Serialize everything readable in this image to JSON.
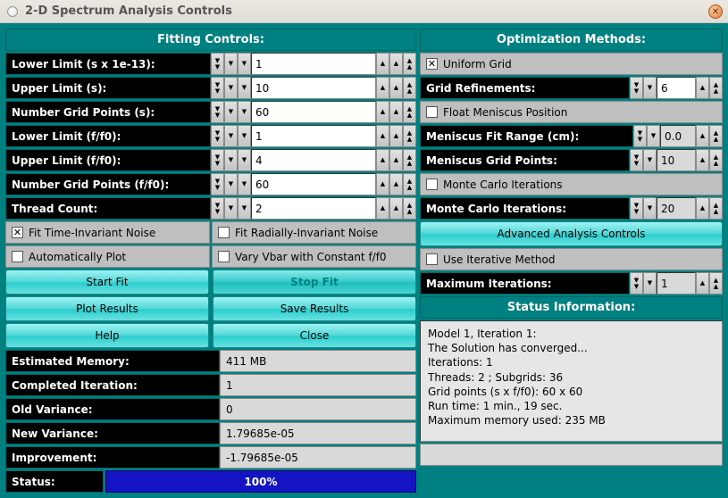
{
  "window": {
    "title": "2-D Spectrum Analysis Controls"
  },
  "left": {
    "header": "Fitting Controls:",
    "fields": {
      "lower_s": {
        "label": "Lower Limit (s x 1e-13):",
        "value": "1"
      },
      "upper_s": {
        "label": "Upper Limit (s):",
        "value": "10"
      },
      "grid_s": {
        "label": "Number Grid Points (s):",
        "value": "60"
      },
      "lower_f": {
        "label": "Lower Limit (f/f0):",
        "value": "1"
      },
      "upper_f": {
        "label": "Upper Limit (f/f0):",
        "value": "4"
      },
      "grid_f": {
        "label": "Number Grid Points (f/f0):",
        "value": "60"
      },
      "threads": {
        "label": "Thread Count:",
        "value": "2"
      }
    },
    "checks": {
      "ti_noise": {
        "label": "Fit Time-Invariant Noise",
        "checked": true
      },
      "ri_noise": {
        "label": "Fit Radially-Invariant Noise",
        "checked": false
      },
      "auto_plot": {
        "label": "Automatically Plot",
        "checked": false
      },
      "vary_vbar": {
        "label": "Vary Vbar with Constant f/f0",
        "checked": false
      }
    },
    "buttons": {
      "start": "Start Fit",
      "stop": "Stop Fit",
      "plot": "Plot Results",
      "save": "Save Results",
      "help": "Help",
      "close": "Close"
    },
    "results": {
      "memory": {
        "label": "Estimated Memory:",
        "value": "411 MB"
      },
      "iter": {
        "label": "Completed Iteration:",
        "value": "1"
      },
      "old_var": {
        "label": "Old Variance:",
        "value": "0"
      },
      "new_var": {
        "label": "New Variance:",
        "value": "1.79685e-05"
      },
      "improve": {
        "label": "Improvement:",
        "value": "-1.79685e-05"
      }
    },
    "status": {
      "label": "Status:",
      "value": "100%"
    }
  },
  "right": {
    "header": "Optimization Methods:",
    "uniform": {
      "label": "Uniform Grid",
      "checked": true
    },
    "grid_ref": {
      "label": "Grid Refinements:",
      "value": "6"
    },
    "float_men": {
      "label": "Float Meniscus Position",
      "checked": false
    },
    "men_range": {
      "label": "Meniscus Fit Range (cm):",
      "value": "0.0"
    },
    "men_grid": {
      "label": "Meniscus Grid Points:",
      "value": "10"
    },
    "mc_iter_chk": {
      "label": "Monte Carlo Iterations",
      "checked": false
    },
    "mc_iter": {
      "label": "Monte Carlo Iterations:",
      "value": "20"
    },
    "adv_btn": "Advanced Analysis Controls",
    "iter_method": {
      "label": "Use Iterative Method",
      "checked": false
    },
    "max_iter": {
      "label": "Maximum Iterations:",
      "value": "1"
    },
    "status_header": "Status Information:",
    "status_text": "Model 1,  Iteration 1:\nThe Solution has converged...\n Iterations:  1\nThreads:  2 ;   Subgrids:  36\nGrid points (s x f/f0):  60 x 60\nRun time:  1 min., 19 sec.\nMaximum memory used:  235 MB"
  }
}
